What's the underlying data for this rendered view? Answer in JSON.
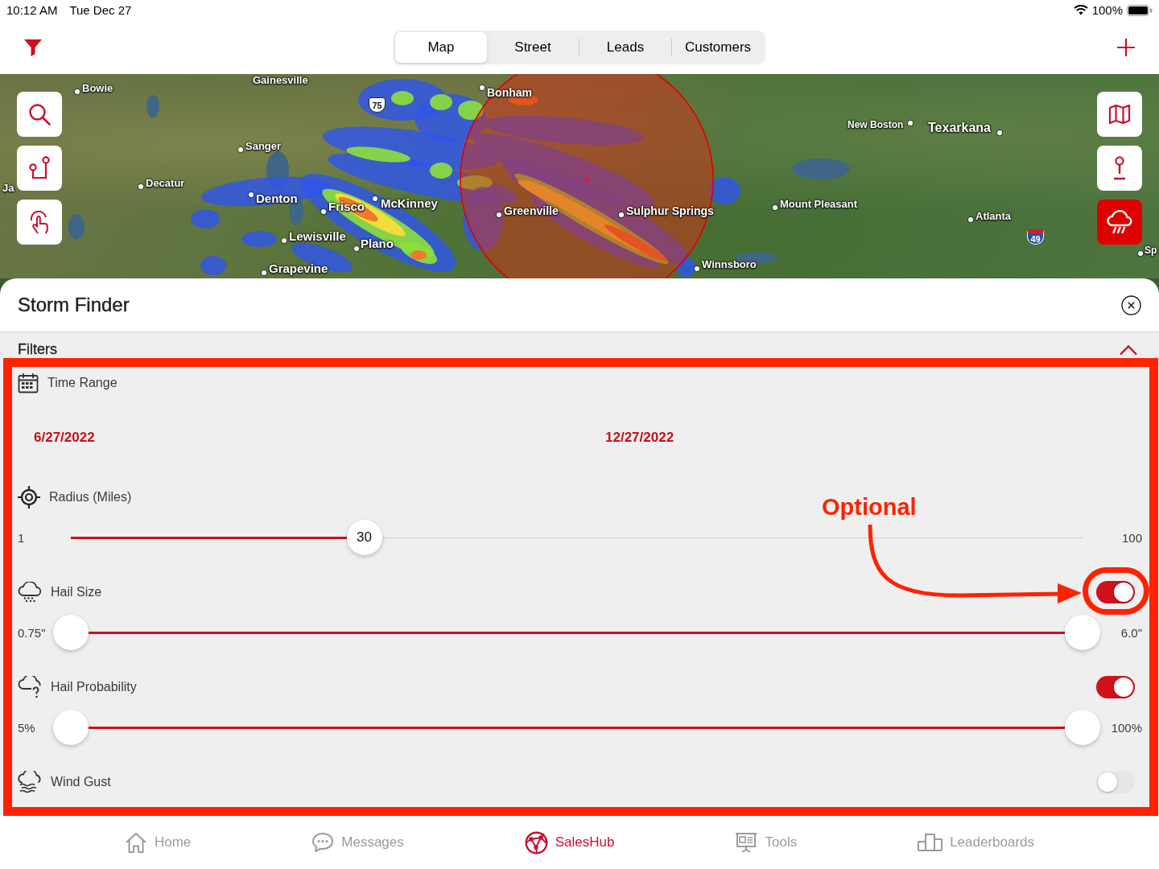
{
  "status_bar": {
    "time": "10:12 AM",
    "date": "Tue Dec 27",
    "battery": "100%"
  },
  "nav": {
    "tabs": [
      {
        "label": "Map",
        "selected": true
      },
      {
        "label": "Street",
        "selected": false
      },
      {
        "label": "Leads",
        "selected": false
      },
      {
        "label": "Customers",
        "selected": false
      }
    ]
  },
  "map": {
    "places": [
      "Bowie",
      "Gainesville",
      "Bonham",
      "New Boston",
      "Texarkana",
      "Sanger",
      "Ja",
      "Decatur",
      "Denton",
      "Frisco",
      "McKinney",
      "Greenville",
      "Sulphur Springs",
      "Mount Pleasant",
      "Atlanta",
      "Lewisville",
      "Plano",
      "Sp",
      "Grapevine",
      "Winnsboro"
    ],
    "highway_shields": [
      {
        "kind": "us",
        "label": "75"
      },
      {
        "kind": "interstate",
        "label": "49"
      }
    ],
    "tools": [
      {
        "kind": "map",
        "selected": false
      },
      {
        "kind": "pin",
        "selected": false
      },
      {
        "kind": "storm",
        "selected": true
      }
    ]
  },
  "panel": {
    "title": "Storm Finder",
    "section": {
      "title": "Filters",
      "expanded": true
    },
    "filters": [
      {
        "kind": "dates",
        "label": "Time Range",
        "start": "6/27/2022",
        "end": "12/27/2022"
      },
      {
        "kind": "slider",
        "label": "Radius (Miles)",
        "min": "1",
        "max": "100",
        "value": "30",
        "level": 0.29
      },
      {
        "kind": "range",
        "label": "Hail Size",
        "on": true,
        "min": "0.75\"",
        "max": "6.0\"",
        "thumbs": [
          {
            "level": 0
          },
          {
            "level": 1
          }
        ]
      },
      {
        "kind": "range",
        "label": "Hail Probability",
        "on": true,
        "min": "5%",
        "max": "100%",
        "thumbs": [
          {
            "level": 0
          },
          {
            "level": 1
          }
        ]
      },
      {
        "kind": "toggle",
        "label": "Wind Gust",
        "on": false
      }
    ]
  },
  "annotation": {
    "label": "Optional"
  },
  "tab_bar": [
    {
      "label": "Home",
      "selected": false
    },
    {
      "label": "Messages",
      "selected": false
    },
    {
      "label": "SalesHub",
      "selected": true
    },
    {
      "label": "Tools",
      "selected": false
    },
    {
      "label": "Leaderboards",
      "selected": false
    }
  ]
}
